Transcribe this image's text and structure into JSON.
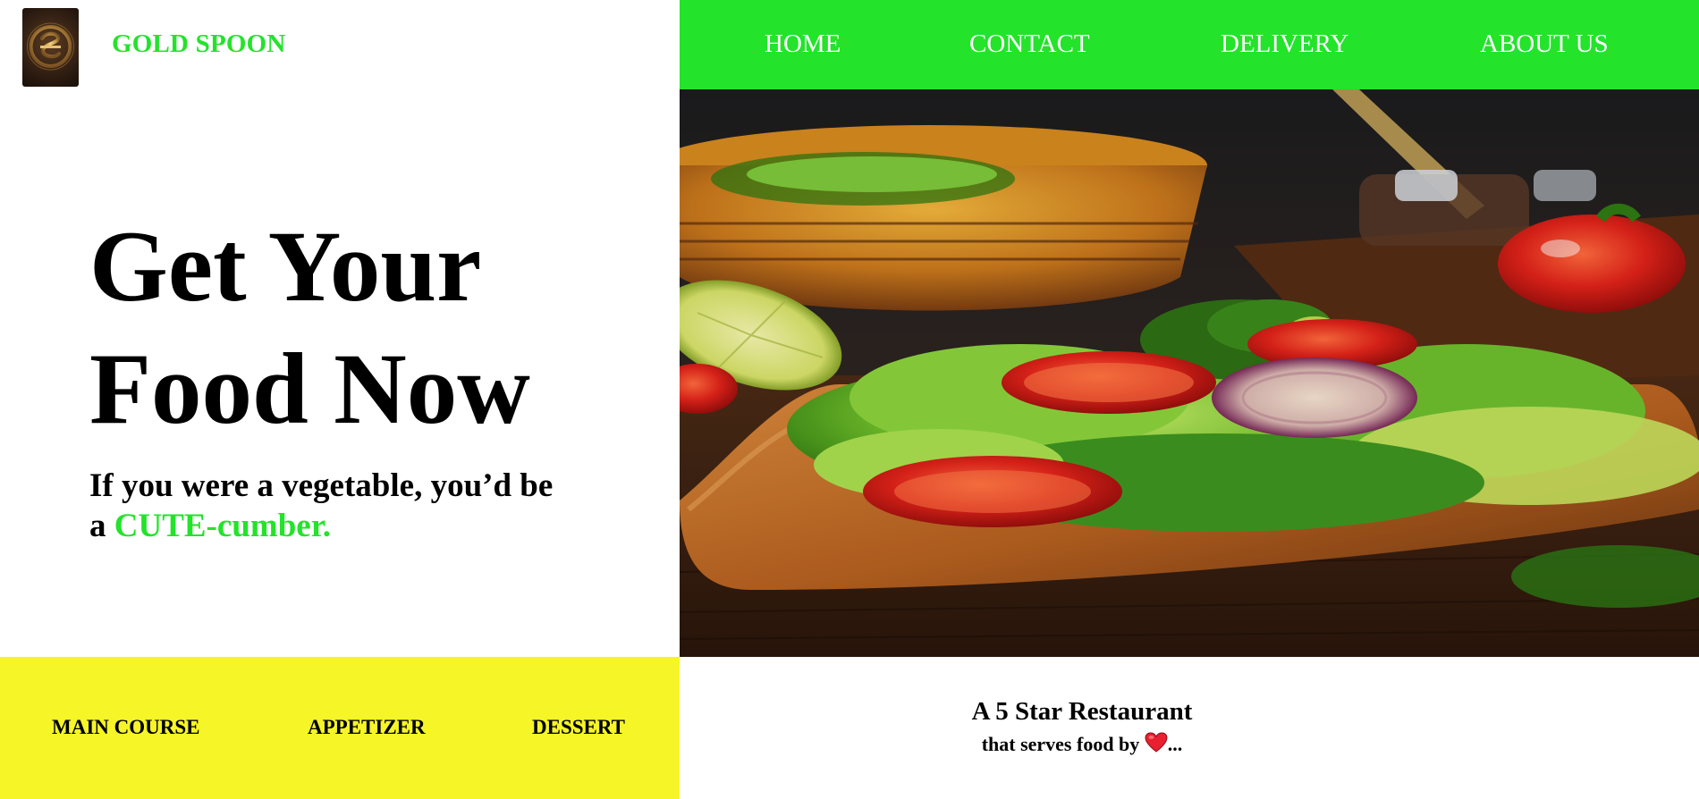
{
  "brand": {
    "name": "GOLD SPOON",
    "logo_icon": "gold-spoon-emblem",
    "color": "#23e32b"
  },
  "nav": {
    "background": "#23e32b",
    "items": [
      {
        "label": "HOME"
      },
      {
        "label": "CONTACT"
      },
      {
        "label": "DELIVERY"
      },
      {
        "label": "ABOUT US"
      }
    ]
  },
  "hero": {
    "title_line1": "Get Your",
    "title_line2": "Food Now",
    "subtitle_line1": "If you were a vegetable, you’d be",
    "subtitle_prefix": "a",
    "subtitle_accent": "CUTE-cumber.",
    "image_icon": "salad-photo"
  },
  "categories": {
    "background": "#f5f527",
    "items": [
      {
        "label": "MAIN COURSE"
      },
      {
        "label": "APPETIZER"
      },
      {
        "label": "DESSERT"
      }
    ]
  },
  "tagline": {
    "title": "A 5 Star Restaurant",
    "sub_text": "that serves food by",
    "sub_suffix": "...",
    "heart_icon": "red-heart-icon"
  }
}
